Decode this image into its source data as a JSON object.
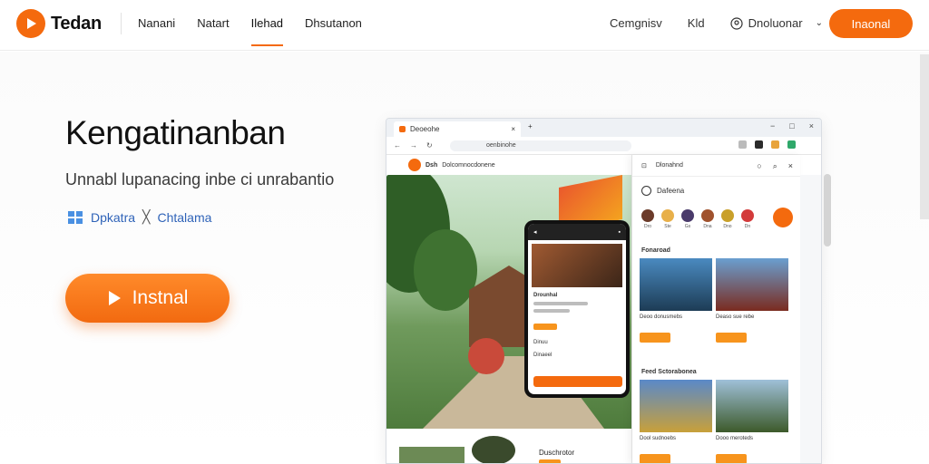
{
  "header": {
    "brand": "Tedan",
    "nav": [
      "Nanani",
      "Natart",
      "Ilehad",
      "Dhsutanon"
    ],
    "active_nav": "Ilehad",
    "links": [
      "Cemgnisv",
      "Kld"
    ],
    "account": "Dnoluonar",
    "cta": "Inaonal"
  },
  "hero": {
    "title": "Kengatinanban",
    "subtitle": "Unnabl lupanacing inbe ci unrabantio",
    "link_1": "Dpkatra",
    "link_separator": "╳",
    "link_2": "Chtalama",
    "button": "Instnal"
  },
  "browser": {
    "tab_title": "Deoeohe",
    "url": "oenbinohe",
    "site_brand": "Dsh",
    "site_name": "Dolcomnocdonene",
    "side_panel": {
      "title": "Dlonahnd",
      "radio_label": "Dafeena",
      "avatars": [
        "Dro",
        "Ste",
        "Gs",
        "Dna",
        "Dno",
        "Dn"
      ],
      "section_1": "Fonaroad",
      "section_2": "Feed Sctorabonea",
      "cards": [
        {
          "caption": "Deoo donusmebs"
        },
        {
          "caption": "Deaso sue rebe"
        },
        {
          "caption": "Dool sudnoebs"
        },
        {
          "caption": "Dooo meroteds"
        }
      ]
    },
    "phone": {
      "title": "Drounhal",
      "rows": [
        "Dinuu",
        "Dinaeel"
      ]
    },
    "bottom_label": "Duschrotor"
  },
  "colors": {
    "accent": "#f46a0e",
    "accent_light": "#f7941d",
    "link": "#2f63b8"
  }
}
